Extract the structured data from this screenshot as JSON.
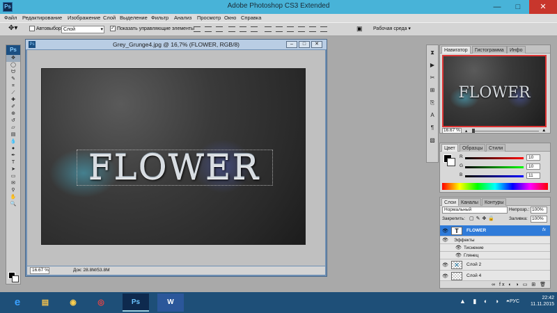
{
  "window": {
    "title": "Adobe Photoshop CS3 Extended",
    "app_icon": "Ps",
    "minimize": "—",
    "maximize": "□",
    "close": "✕"
  },
  "menu": [
    "Файл",
    "Редактирование",
    "Изображение",
    "Слой",
    "Выделение",
    "Фильтр",
    "Анализ",
    "Просмотр",
    "Окно",
    "Справка"
  ],
  "options_bar": {
    "autoselect_label": "Автовыбор:",
    "autoselect_value": "Слой",
    "show_controls_label": "Показать управляющие элементы",
    "workspace_label": "Рабочая среда ▾"
  },
  "toolbox": {
    "logo": "Ps",
    "tools": [
      "move-tool",
      "marquee-tool",
      "lasso-tool",
      "quick-select-tool",
      "crop-tool",
      "slice-tool",
      "healing-tool",
      "brush-tool",
      "clone-tool",
      "history-brush-tool",
      "eraser-tool",
      "gradient-tool",
      "blur-tool",
      "dodge-tool",
      "pen-tool",
      "type-tool",
      "path-select-tool",
      "shape-tool",
      "notes-tool",
      "eyedropper-tool",
      "hand-tool",
      "zoom-tool"
    ]
  },
  "document": {
    "title": "Grey_Grunge4.jpg @ 16,7% (FLOWER, RGB/8)",
    "icon": "Ps",
    "art_text": "FLOWER",
    "zoom": "16.67 %",
    "status": "Док: 28.8M/53.8M"
  },
  "navigator": {
    "tabs": [
      "Навигатор",
      "Гистограмма",
      "Инфо"
    ],
    "thumb_text": "FLOWER",
    "zoom": "16.67 %"
  },
  "color_panel": {
    "tabs": [
      "Цвет",
      "Образцы",
      "Стили"
    ],
    "channels": [
      {
        "label": "R",
        "value": "10",
        "color": "#d22"
      },
      {
        "label": "G",
        "value": "10",
        "color": "#2a2"
      },
      {
        "label": "B",
        "value": "11",
        "color": "#22d"
      }
    ]
  },
  "layers_panel": {
    "tabs": [
      "Слои",
      "Каналы",
      "Контуры"
    ],
    "blend_mode": "Нормальный",
    "opacity_label": "Непрозр.:",
    "opacity": "100%",
    "lock_label": "Закрепить:",
    "fill_label": "Заливка:",
    "fill": "100%",
    "rows": [
      {
        "name": "FLOWER",
        "selected": true,
        "thumb": "T",
        "fx": "fx"
      },
      {
        "name": "Эффекты",
        "selected": false
      },
      {
        "name": "Тиснение",
        "selected": false
      },
      {
        "name": "Глянец",
        "selected": false
      },
      {
        "name": "Слой 2",
        "selected": false
      },
      {
        "name": "Слой 4",
        "selected": false
      }
    ]
  },
  "taskbar": {
    "apps": [
      "ie-icon",
      "explorer-icon",
      "ffdl-icon",
      "chrome-icon",
      "photoshop-icon",
      "word-icon"
    ],
    "ps_label": "Ps",
    "word_label": "W",
    "lang": "РУС",
    "time": "22:42",
    "date": "11.11.2015"
  }
}
